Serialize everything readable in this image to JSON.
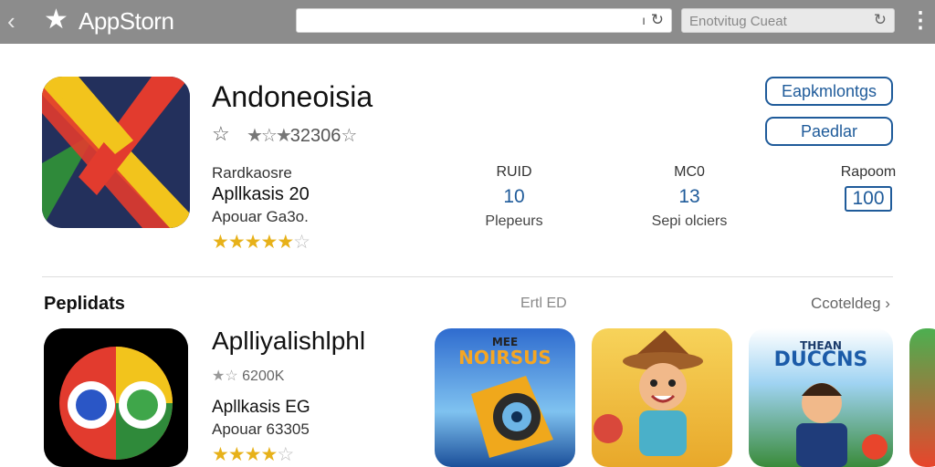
{
  "topbar": {
    "back_icon": "chevron-left-icon",
    "title": "AppStorn",
    "url_value": "",
    "search_placeholder": "Enotvitug Cueat"
  },
  "app": {
    "name": "Andoneoisia",
    "rating_text": "32306",
    "meta1": "Rardkaosre",
    "meta2": "Apllkasis 20",
    "meta3": "Apouar Ga3o.",
    "stars_filled": 4.5,
    "stars_total": 5,
    "stats": [
      {
        "label": "RUID",
        "value": "10",
        "sub": "Plepeurs"
      },
      {
        "label": "MC0",
        "value": "13",
        "sub": "Sepi olciers"
      },
      {
        "label": "Rapoom",
        "value": "100",
        "sub": ""
      }
    ],
    "buttons": {
      "primary": "Eapkmlontgs",
      "secondary": "Paedlar"
    }
  },
  "section": {
    "title": "Peplidats",
    "middle_text": "Ertl ED",
    "link": "Ccoteldeg"
  },
  "app2": {
    "name": "Aplliyalishlphl",
    "rating_text": "6200K",
    "meta": "Apllkasis EG",
    "meta2": "Apouar 63305",
    "stars_filled": 4.5,
    "stars_total": 5
  },
  "tiles": [
    {
      "label": "NOIRSUS",
      "tag": "MEE"
    },
    {
      "label": ""
    },
    {
      "label": "DUCCNS",
      "tag": "THEAN"
    },
    {
      "label": ""
    }
  ],
  "colors": {
    "topbar": "#8c8c8c",
    "accent": "#1f5b9a",
    "star_gold": "#e7b119"
  }
}
